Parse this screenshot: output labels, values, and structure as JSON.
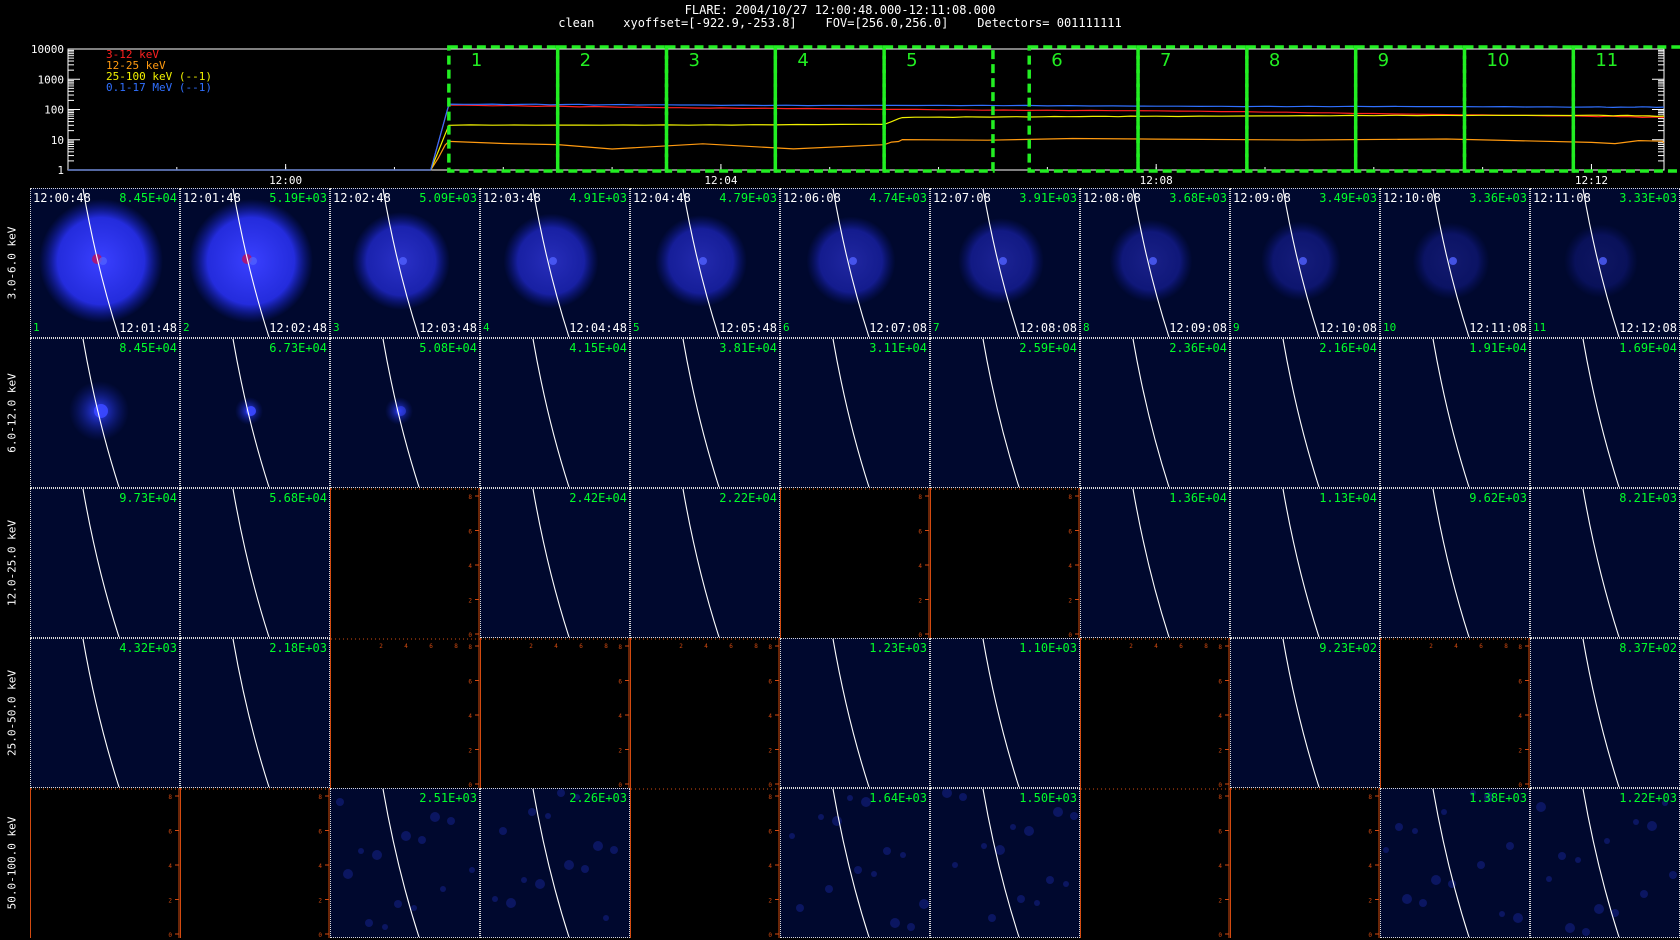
{
  "header": {
    "line1": "FLARE: 2004/10/27 12:00:48.000-12:11:08.000",
    "line2": "clean    xyoffset=[-922.9,-253.8]    FOV=[256.0,256.0]    Detectors= 001111111"
  },
  "chart_data": [
    {
      "type": "line",
      "y_scale": "log",
      "ylim": [
        1,
        10000
      ],
      "y_ticks": [
        "10000",
        "1000",
        "100",
        "10",
        "1"
      ],
      "x_ticks": [
        "12:00",
        "12:04",
        "12:08",
        "12:12"
      ],
      "xlim": [
        "11:58:00",
        "12:12:40"
      ],
      "series": [
        {
          "name": "3-12 keV",
          "color": "#ff2020",
          "x": [
            "11:58:00",
            "12:01:20",
            "12:01:30",
            "12:04:00",
            "12:08:00",
            "12:12:00",
            "12:12:40"
          ],
          "y": [
            1,
            1,
            140,
            110,
            90,
            60,
            55
          ]
        },
        {
          "name": "12-25 keV",
          "color": "#ff9a10",
          "x": [
            "11:58:00",
            "12:01:20",
            "12:01:30",
            "12:03:00",
            "12:05:30",
            "12:05:40",
            "12:08:00",
            "12:12:00",
            "12:12:40"
          ],
          "y": [
            1,
            1,
            9,
            6,
            6,
            10,
            10,
            9,
            8
          ]
        },
        {
          "name": "25-100 keV (--1)",
          "color": "#f0f000",
          "x": [
            "11:58:00",
            "12:01:20",
            "12:01:30",
            "12:05:30",
            "12:05:40",
            "12:08:00",
            "12:12:00",
            "12:12:40"
          ],
          "y": [
            1,
            1,
            30,
            32,
            55,
            60,
            65,
            60
          ]
        },
        {
          "name": "0.1-17 MeV (--1)",
          "color": "#3070ff",
          "x": [
            "11:58:00",
            "12:01:20",
            "12:01:30",
            "12:04:00",
            "12:08:00",
            "12:12:00",
            "12:12:40"
          ],
          "y": [
            1,
            1,
            150,
            140,
            130,
            120,
            120
          ]
        }
      ],
      "intervals": [
        {
          "label": "1",
          "start": "12:01:30",
          "end": "12:02:30"
        },
        {
          "label": "2",
          "start": "12:02:30",
          "end": "12:03:30"
        },
        {
          "label": "3",
          "start": "12:03:30",
          "end": "12:04:30"
        },
        {
          "label": "4",
          "start": "12:04:30",
          "end": "12:05:30"
        },
        {
          "label": "5",
          "start": "12:05:30",
          "end": "12:06:30"
        },
        {
          "label": "6",
          "start": "12:06:50",
          "end": "12:07:50"
        },
        {
          "label": "7",
          "start": "12:07:50",
          "end": "12:08:50"
        },
        {
          "label": "8",
          "start": "12:08:50",
          "end": "12:09:50"
        },
        {
          "label": "9",
          "start": "12:09:50",
          "end": "12:10:50"
        },
        {
          "label": "10",
          "start": "12:10:50",
          "end": "12:11:50"
        },
        {
          "label": "11",
          "start": "12:11:50",
          "end": "12:12:50"
        }
      ],
      "interval_color": "#22ee22"
    },
    {
      "type": "heatmap",
      "row_labels": [
        "3.0-6.0 keV",
        "6.0-12.0 keV",
        "12.0-25.0 keV",
        "25.0-50.0 keV",
        "50.0-100.0 keV"
      ],
      "col_start_times": [
        "12:00:48",
        "12:01:48",
        "12:02:48",
        "12:03:48",
        "12:04:48",
        "12:06:08",
        "12:07:08",
        "12:08:08",
        "12:09:08",
        "12:10:08",
        "12:11:08"
      ],
      "col_end_times": [
        "12:01:48",
        "12:02:48",
        "12:03:48",
        "12:04:48",
        "12:05:48",
        "12:07:08",
        "12:08:08",
        "12:09:08",
        "12:10:08",
        "12:11:08",
        "12:12:08"
      ],
      "col_numbers": [
        "1",
        "2",
        "3",
        "4",
        "5",
        "6",
        "7",
        "8",
        "9",
        "10",
        "11"
      ],
      "peaks": [
        [
          "8.45E+04",
          "5.19E+03",
          "5.09E+03",
          "4.91E+03",
          "4.79E+03",
          "4.74E+03",
          "3.91E+03",
          "3.68E+03",
          "3.49E+03",
          "3.36E+03",
          "3.33E+03"
        ],
        [
          "8.45E+04",
          "6.73E+04",
          "5.08E+04",
          "4.15E+04",
          "3.81E+04",
          "3.11E+04",
          "2.59E+04",
          "2.36E+04",
          "2.16E+04",
          "1.91E+04",
          "1.69E+04"
        ],
        [
          "9.73E+04",
          "5.68E+04",
          null,
          "2.42E+04",
          "2.22E+04",
          null,
          null,
          "1.36E+04",
          "1.13E+04",
          "9.62E+03",
          "8.21E+03"
        ],
        [
          "4.32E+03",
          "2.18E+03",
          null,
          null,
          null,
          "1.23E+03",
          "1.10E+03",
          null,
          "9.23E+02",
          null,
          "8.37E+02"
        ],
        [
          null,
          null,
          "2.51E+03",
          "2.26E+03",
          null,
          "1.64E+03",
          "1.50E+03",
          null,
          null,
          "1.38E+03",
          "1.22E+03"
        ]
      ],
      "axis_ticks": [
        "0",
        "2",
        "4",
        "6",
        "8"
      ]
    }
  ]
}
